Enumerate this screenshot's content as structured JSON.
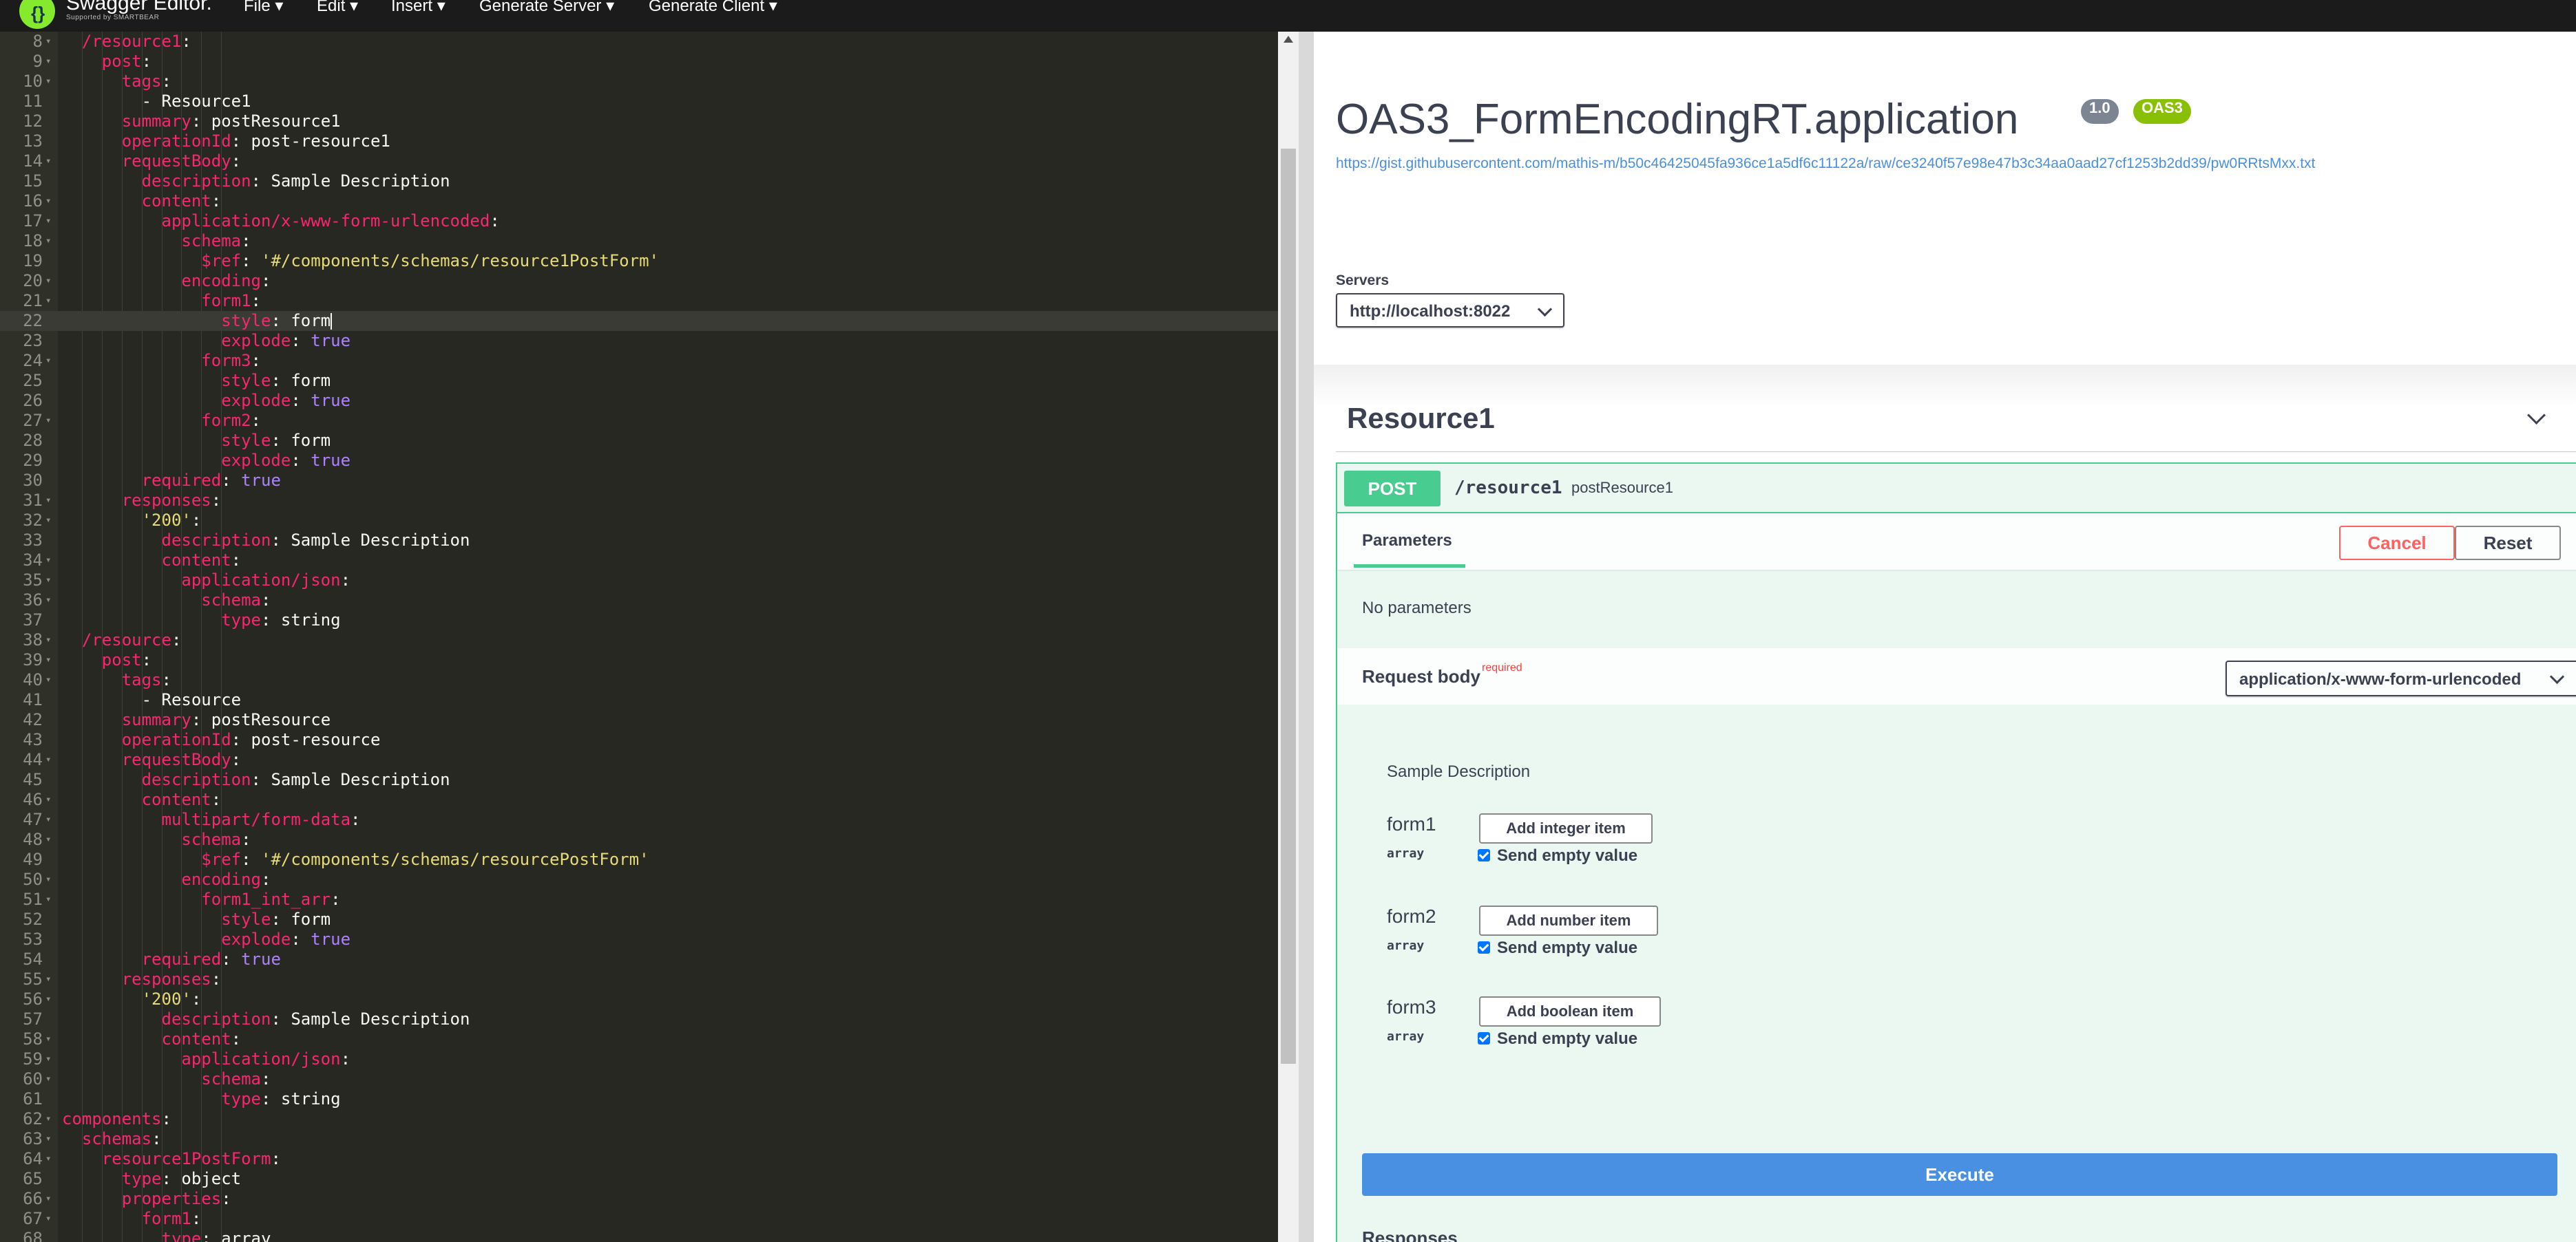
{
  "header": {
    "logo_glyph": "{}",
    "brand": "Swagger Editor.",
    "brand_sub": "Supported by SMARTBEAR",
    "menu": [
      {
        "label": "File ▾"
      },
      {
        "label": "Edit ▾"
      },
      {
        "label": "Insert ▾"
      },
      {
        "label": "Generate Server ▾"
      },
      {
        "label": "Generate Client ▾"
      }
    ]
  },
  "editor": {
    "lines": [
      {
        "n": "8",
        "fold": true,
        "indent": 1,
        "parts": [
          [
            "k",
            "/resource1"
          ],
          [
            "v",
            ":"
          ]
        ]
      },
      {
        "n": "9",
        "fold": true,
        "indent": 2,
        "parts": [
          [
            "k",
            "post"
          ],
          [
            "v",
            ":"
          ]
        ]
      },
      {
        "n": "10",
        "fold": true,
        "indent": 3,
        "parts": [
          [
            "k",
            "tags"
          ],
          [
            "v",
            ":"
          ]
        ]
      },
      {
        "n": "11",
        "fold": false,
        "indent": 4,
        "parts": [
          [
            "v",
            "- Resource1"
          ]
        ]
      },
      {
        "n": "12",
        "fold": false,
        "indent": 3,
        "parts": [
          [
            "k",
            "summary"
          ],
          [
            "v",
            ": postResource1"
          ]
        ]
      },
      {
        "n": "13",
        "fold": false,
        "indent": 3,
        "parts": [
          [
            "k",
            "operationId"
          ],
          [
            "v",
            ": post-resource1"
          ]
        ]
      },
      {
        "n": "14",
        "fold": true,
        "indent": 3,
        "parts": [
          [
            "k",
            "requestBody"
          ],
          [
            "v",
            ":"
          ]
        ]
      },
      {
        "n": "15",
        "fold": false,
        "indent": 4,
        "parts": [
          [
            "k",
            "description"
          ],
          [
            "v",
            ": Sample Description"
          ]
        ]
      },
      {
        "n": "16",
        "fold": true,
        "indent": 4,
        "parts": [
          [
            "k",
            "content"
          ],
          [
            "v",
            ":"
          ]
        ]
      },
      {
        "n": "17",
        "fold": true,
        "indent": 5,
        "parts": [
          [
            "k",
            "application/x-www-form-urlencoded"
          ],
          [
            "v",
            ":"
          ]
        ]
      },
      {
        "n": "18",
        "fold": true,
        "indent": 6,
        "parts": [
          [
            "k",
            "schema"
          ],
          [
            "v",
            ":"
          ]
        ]
      },
      {
        "n": "19",
        "fold": false,
        "indent": 7,
        "parts": [
          [
            "k",
            "$ref"
          ],
          [
            "v",
            ": "
          ],
          [
            "s",
            "'#/components/schemas/resource1PostForm'"
          ]
        ]
      },
      {
        "n": "20",
        "fold": true,
        "indent": 6,
        "parts": [
          [
            "k",
            "encoding"
          ],
          [
            "v",
            ":"
          ]
        ]
      },
      {
        "n": "21",
        "fold": true,
        "indent": 7,
        "parts": [
          [
            "k",
            "form1"
          ],
          [
            "v",
            ":"
          ]
        ]
      },
      {
        "n": "22",
        "fold": false,
        "indent": 8,
        "active": true,
        "parts": [
          [
            "k",
            "style"
          ],
          [
            "v",
            ": form"
          ]
        ]
      },
      {
        "n": "23",
        "fold": false,
        "indent": 8,
        "parts": [
          [
            "k",
            "explode"
          ],
          [
            "v",
            ": "
          ],
          [
            "b",
            "true"
          ]
        ]
      },
      {
        "n": "24",
        "fold": true,
        "indent": 7,
        "parts": [
          [
            "k",
            "form3"
          ],
          [
            "v",
            ":"
          ]
        ]
      },
      {
        "n": "25",
        "fold": false,
        "indent": 8,
        "parts": [
          [
            "k",
            "style"
          ],
          [
            "v",
            ": form"
          ]
        ]
      },
      {
        "n": "26",
        "fold": false,
        "indent": 8,
        "parts": [
          [
            "k",
            "explode"
          ],
          [
            "v",
            ": "
          ],
          [
            "b",
            "true"
          ]
        ]
      },
      {
        "n": "27",
        "fold": true,
        "indent": 7,
        "parts": [
          [
            "k",
            "form2"
          ],
          [
            "v",
            ":"
          ]
        ]
      },
      {
        "n": "28",
        "fold": false,
        "indent": 8,
        "parts": [
          [
            "k",
            "style"
          ],
          [
            "v",
            ": form"
          ]
        ]
      },
      {
        "n": "29",
        "fold": false,
        "indent": 8,
        "parts": [
          [
            "k",
            "explode"
          ],
          [
            "v",
            ": "
          ],
          [
            "b",
            "true"
          ]
        ]
      },
      {
        "n": "30",
        "fold": false,
        "indent": 4,
        "parts": [
          [
            "k",
            "required"
          ],
          [
            "v",
            ": "
          ],
          [
            "b",
            "true"
          ]
        ]
      },
      {
        "n": "31",
        "fold": true,
        "indent": 3,
        "parts": [
          [
            "k",
            "responses"
          ],
          [
            "v",
            ":"
          ]
        ]
      },
      {
        "n": "32",
        "fold": true,
        "indent": 4,
        "parts": [
          [
            "s",
            "'200'"
          ],
          [
            "v",
            ":"
          ]
        ]
      },
      {
        "n": "33",
        "fold": false,
        "indent": 5,
        "parts": [
          [
            "k",
            "description"
          ],
          [
            "v",
            ": Sample Description"
          ]
        ]
      },
      {
        "n": "34",
        "fold": true,
        "indent": 5,
        "parts": [
          [
            "k",
            "content"
          ],
          [
            "v",
            ":"
          ]
        ]
      },
      {
        "n": "35",
        "fold": true,
        "indent": 6,
        "parts": [
          [
            "k",
            "application/json"
          ],
          [
            "v",
            ":"
          ]
        ]
      },
      {
        "n": "36",
        "fold": true,
        "indent": 7,
        "parts": [
          [
            "k",
            "schema"
          ],
          [
            "v",
            ":"
          ]
        ]
      },
      {
        "n": "37",
        "fold": false,
        "indent": 8,
        "parts": [
          [
            "k",
            "type"
          ],
          [
            "v",
            ": string"
          ]
        ]
      },
      {
        "n": "38",
        "fold": true,
        "indent": 1,
        "parts": [
          [
            "k",
            "/resource"
          ],
          [
            "v",
            ":"
          ]
        ]
      },
      {
        "n": "39",
        "fold": true,
        "indent": 2,
        "parts": [
          [
            "k",
            "post"
          ],
          [
            "v",
            ":"
          ]
        ]
      },
      {
        "n": "40",
        "fold": true,
        "indent": 3,
        "parts": [
          [
            "k",
            "tags"
          ],
          [
            "v",
            ":"
          ]
        ]
      },
      {
        "n": "41",
        "fold": false,
        "indent": 4,
        "parts": [
          [
            "v",
            "- Resource"
          ]
        ]
      },
      {
        "n": "42",
        "fold": false,
        "indent": 3,
        "parts": [
          [
            "k",
            "summary"
          ],
          [
            "v",
            ": postResource"
          ]
        ]
      },
      {
        "n": "43",
        "fold": false,
        "indent": 3,
        "parts": [
          [
            "k",
            "operationId"
          ],
          [
            "v",
            ": post-resource"
          ]
        ]
      },
      {
        "n": "44",
        "fold": true,
        "indent": 3,
        "parts": [
          [
            "k",
            "requestBody"
          ],
          [
            "v",
            ":"
          ]
        ]
      },
      {
        "n": "45",
        "fold": false,
        "indent": 4,
        "parts": [
          [
            "k",
            "description"
          ],
          [
            "v",
            ": Sample Description"
          ]
        ]
      },
      {
        "n": "46",
        "fold": true,
        "indent": 4,
        "parts": [
          [
            "k",
            "content"
          ],
          [
            "v",
            ":"
          ]
        ]
      },
      {
        "n": "47",
        "fold": true,
        "indent": 5,
        "parts": [
          [
            "k",
            "multipart/form-data"
          ],
          [
            "v",
            ":"
          ]
        ]
      },
      {
        "n": "48",
        "fold": true,
        "indent": 6,
        "parts": [
          [
            "k",
            "schema"
          ],
          [
            "v",
            ":"
          ]
        ]
      },
      {
        "n": "49",
        "fold": false,
        "indent": 7,
        "parts": [
          [
            "k",
            "$ref"
          ],
          [
            "v",
            ": "
          ],
          [
            "s",
            "'#/components/schemas/resourcePostForm'"
          ]
        ]
      },
      {
        "n": "50",
        "fold": true,
        "indent": 6,
        "parts": [
          [
            "k",
            "encoding"
          ],
          [
            "v",
            ":"
          ]
        ]
      },
      {
        "n": "51",
        "fold": true,
        "indent": 7,
        "parts": [
          [
            "k",
            "form1_int_arr"
          ],
          [
            "v",
            ":"
          ]
        ]
      },
      {
        "n": "52",
        "fold": false,
        "indent": 8,
        "parts": [
          [
            "k",
            "style"
          ],
          [
            "v",
            ": form"
          ]
        ]
      },
      {
        "n": "53",
        "fold": false,
        "indent": 8,
        "parts": [
          [
            "k",
            "explode"
          ],
          [
            "v",
            ": "
          ],
          [
            "b",
            "true"
          ]
        ]
      },
      {
        "n": "54",
        "fold": false,
        "indent": 4,
        "parts": [
          [
            "k",
            "required"
          ],
          [
            "v",
            ": "
          ],
          [
            "b",
            "true"
          ]
        ]
      },
      {
        "n": "55",
        "fold": true,
        "indent": 3,
        "parts": [
          [
            "k",
            "responses"
          ],
          [
            "v",
            ":"
          ]
        ]
      },
      {
        "n": "56",
        "fold": true,
        "indent": 4,
        "parts": [
          [
            "s",
            "'200'"
          ],
          [
            "v",
            ":"
          ]
        ]
      },
      {
        "n": "57",
        "fold": false,
        "indent": 5,
        "parts": [
          [
            "k",
            "description"
          ],
          [
            "v",
            ": Sample Description"
          ]
        ]
      },
      {
        "n": "58",
        "fold": true,
        "indent": 5,
        "parts": [
          [
            "k",
            "content"
          ],
          [
            "v",
            ":"
          ]
        ]
      },
      {
        "n": "59",
        "fold": true,
        "indent": 6,
        "parts": [
          [
            "k",
            "application/json"
          ],
          [
            "v",
            ":"
          ]
        ]
      },
      {
        "n": "60",
        "fold": true,
        "indent": 7,
        "parts": [
          [
            "k",
            "schema"
          ],
          [
            "v",
            ":"
          ]
        ]
      },
      {
        "n": "61",
        "fold": false,
        "indent": 8,
        "parts": [
          [
            "k",
            "type"
          ],
          [
            "v",
            ": string"
          ]
        ]
      },
      {
        "n": "62",
        "fold": true,
        "indent": 0,
        "parts": [
          [
            "k",
            "components"
          ],
          [
            "v",
            ":"
          ]
        ]
      },
      {
        "n": "63",
        "fold": true,
        "indent": 1,
        "parts": [
          [
            "k",
            "schemas"
          ],
          [
            "v",
            ":"
          ]
        ]
      },
      {
        "n": "64",
        "fold": true,
        "indent": 2,
        "parts": [
          [
            "k",
            "resource1PostForm"
          ],
          [
            "v",
            ":"
          ]
        ]
      },
      {
        "n": "65",
        "fold": false,
        "indent": 3,
        "parts": [
          [
            "k",
            "type"
          ],
          [
            "v",
            ": object"
          ]
        ]
      },
      {
        "n": "66",
        "fold": true,
        "indent": 3,
        "parts": [
          [
            "k",
            "properties"
          ],
          [
            "v",
            ":"
          ]
        ]
      },
      {
        "n": "67",
        "fold": true,
        "indent": 4,
        "parts": [
          [
            "k",
            "form1"
          ],
          [
            "v",
            ":"
          ]
        ]
      },
      {
        "n": "68",
        "fold": false,
        "indent": 5,
        "parts": [
          [
            "k",
            "type"
          ],
          [
            "v",
            ": array"
          ]
        ]
      }
    ]
  },
  "info": {
    "title": "OAS3_FormEncodingRT.application",
    "version": "1.0",
    "oas_badge": "OAS3",
    "spec_url": "https://gist.githubusercontent.com/mathis-m/b50c46425045fa936ce1a5df6c11122a/raw/ce3240f57e98e47b3c34aa0aad27cf1253b2dd39/pw0RRtsMxx.txt"
  },
  "servers": {
    "label": "Servers",
    "selected": "http://localhost:8022"
  },
  "tag": {
    "name": "Resource1"
  },
  "operation": {
    "method": "POST",
    "path": "/resource1",
    "summary": "postResource1",
    "params_tab": "Parameters",
    "cancel_label": "Cancel",
    "reset_label": "Reset",
    "no_params": "No parameters",
    "request_body_label": "Request body",
    "required_label": "required",
    "content_type": "application/x-www-form-urlencoded",
    "description": "Sample Description",
    "fields": [
      {
        "name": "form1",
        "type": "array",
        "add_label": "Add integer item",
        "send_empty": "Send empty value"
      },
      {
        "name": "form2",
        "type": "array",
        "add_label": "Add number item",
        "send_empty": "Send empty value"
      },
      {
        "name": "form3",
        "type": "array",
        "add_label": "Add boolean item",
        "send_empty": "Send empty value"
      }
    ],
    "execute_label": "Execute",
    "responses_label": "Responses"
  }
}
